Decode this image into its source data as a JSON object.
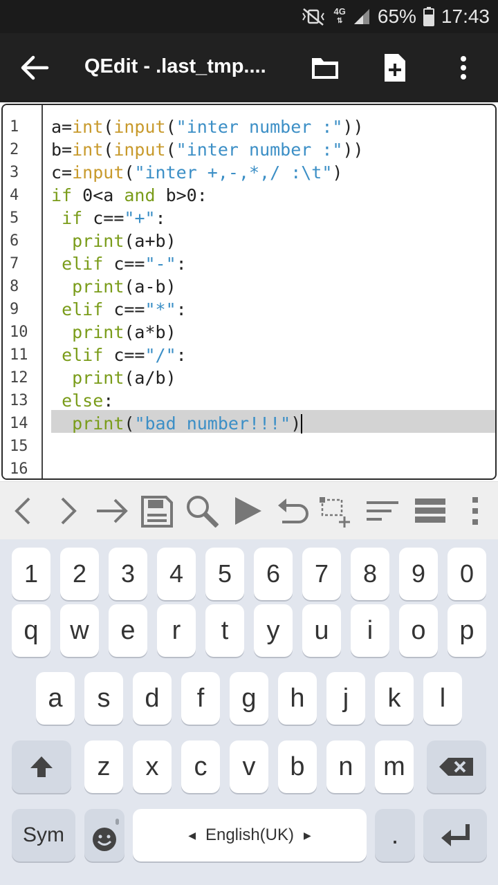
{
  "status": {
    "battery": "65%",
    "time": "17:43",
    "network": "4G"
  },
  "appbar": {
    "title": "QEdit - .last_tmp...."
  },
  "editor": {
    "line_numbers": [
      "1",
      "2",
      "3",
      "4",
      "5",
      "6",
      "7",
      "8",
      "9",
      "10",
      "11",
      "12",
      "13",
      "14",
      "15",
      "16"
    ],
    "highlighted_line": 14,
    "lines": [
      "a=int(input(\"inter number :\"))",
      "b=int(input(\"inter number :\"))",
      "c=input(\"inter +,-,*,/ :\\t\")",
      "if 0<a and b>0:",
      " if c==\"+\":",
      "  print(a+b)",
      " elif c==\"-\":",
      "  print(a-b)",
      " elif c==\"*\":",
      "  print(a*b)",
      " elif c==\"/\":",
      "  print(a/b)",
      " else:",
      "  print(\"bad number!!!\")",
      "",
      ""
    ]
  },
  "toolbar": {
    "icons": [
      "chevron-left-icon",
      "chevron-right-icon",
      "arrow-right-icon",
      "save-icon",
      "search-icon",
      "play-icon",
      "undo-icon",
      "add-selection-icon",
      "sort-lines-icon",
      "list-icon",
      "more-vert-icon"
    ]
  },
  "keyboard": {
    "number_row": [
      "1",
      "2",
      "3",
      "4",
      "5",
      "6",
      "7",
      "8",
      "9",
      "0"
    ],
    "row1": [
      "q",
      "w",
      "e",
      "r",
      "t",
      "y",
      "u",
      "i",
      "o",
      "p"
    ],
    "row2": [
      "a",
      "s",
      "d",
      "f",
      "g",
      "h",
      "j",
      "k",
      "l"
    ],
    "row3": [
      "z",
      "x",
      "c",
      "v",
      "b",
      "n",
      "m"
    ],
    "sym_label": "Sym",
    "space_label": "English(UK)",
    "period_label": "."
  }
}
